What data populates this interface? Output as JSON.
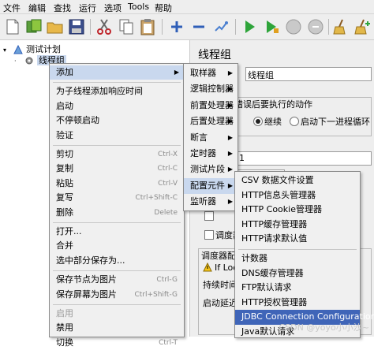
{
  "menubar": {
    "items": [
      "文件",
      "编辑",
      "查找",
      "运行",
      "选项",
      "Tools",
      "帮助"
    ]
  },
  "tree": {
    "test_plan": "测试计划",
    "thread_group": "线程组"
  },
  "right_panel": {
    "title": "线程组",
    "name_field_value": "线程组",
    "error_action_label": "错误后要执行的动作",
    "radio_continue": "继续",
    "radio_next_loop": "启动下一进程循环",
    "field_value_1": "1",
    "loop_fragment": "If Loop",
    "checkbox_fragment": "调度器",
    "scheduler_config": "调度器配",
    "duration_label": "持续时间",
    "startup_delay_label": "启动延迟"
  },
  "context_menu": {
    "items": [
      {
        "label": "添加",
        "submenu": true,
        "selected": true
      },
      {
        "sep": true
      },
      {
        "label": "为子线程添加响应时间"
      },
      {
        "label": "启动"
      },
      {
        "label": "不停顿启动"
      },
      {
        "label": "验证"
      },
      {
        "sep": true
      },
      {
        "label": "剪切",
        "shortcut": "Ctrl-X"
      },
      {
        "label": "复制",
        "shortcut": "Ctrl-C"
      },
      {
        "label": "粘贴",
        "shortcut": "Ctrl-V"
      },
      {
        "label": "复写",
        "shortcut": "Ctrl+Shift-C"
      },
      {
        "label": "删除",
        "shortcut": "Delete"
      },
      {
        "sep": true
      },
      {
        "label": "打开..."
      },
      {
        "label": "合并"
      },
      {
        "label": "选中部分保存为..."
      },
      {
        "sep": true
      },
      {
        "label": "保存节点为图片",
        "shortcut": "Ctrl-G"
      },
      {
        "label": "保存屏幕为图片",
        "shortcut": "Ctrl+Shift-G"
      },
      {
        "sep": true
      },
      {
        "label": "启用",
        "disabled": true
      },
      {
        "label": "禁用"
      },
      {
        "label": "切换",
        "shortcut": "Ctrl-T"
      }
    ]
  },
  "add_submenu": {
    "items": [
      {
        "label": "取样器",
        "submenu": true
      },
      {
        "label": "逻辑控制器",
        "submenu": true
      },
      {
        "label": "前置处理器",
        "submenu": true
      },
      {
        "label": "后置处理器",
        "submenu": true
      },
      {
        "label": "断言",
        "submenu": true
      },
      {
        "label": "定时器",
        "submenu": true
      },
      {
        "label": "测试片段",
        "submenu": true
      },
      {
        "label": "配置元件",
        "submenu": true,
        "selected": true
      },
      {
        "label": "监听器",
        "submenu": true
      }
    ]
  },
  "config_submenu": {
    "items": [
      {
        "label": "CSV 数据文件设置"
      },
      {
        "label": "HTTP信息头管理器"
      },
      {
        "label": "HTTP Cookie管理器"
      },
      {
        "label": "HTTP缓存管理器"
      },
      {
        "label": "HTTP请求默认值"
      },
      {
        "sep": true
      },
      {
        "label": "计数器"
      },
      {
        "label": "DNS缓存管理器"
      },
      {
        "label": "FTP默认请求"
      },
      {
        "label": "HTTP授权管理器"
      },
      {
        "label": "JDBC Connection Configuration",
        "highlighted": true
      },
      {
        "label": "Java默认请求"
      }
    ]
  },
  "watermark": "CSDN @yoyo小小沙~",
  "colors": {
    "menu_bg": "#f0f0f0",
    "selected_bg": "#c9d8ee",
    "highlight_bg": "#3f65b8",
    "toolbar_bg": "#eeeeee"
  }
}
